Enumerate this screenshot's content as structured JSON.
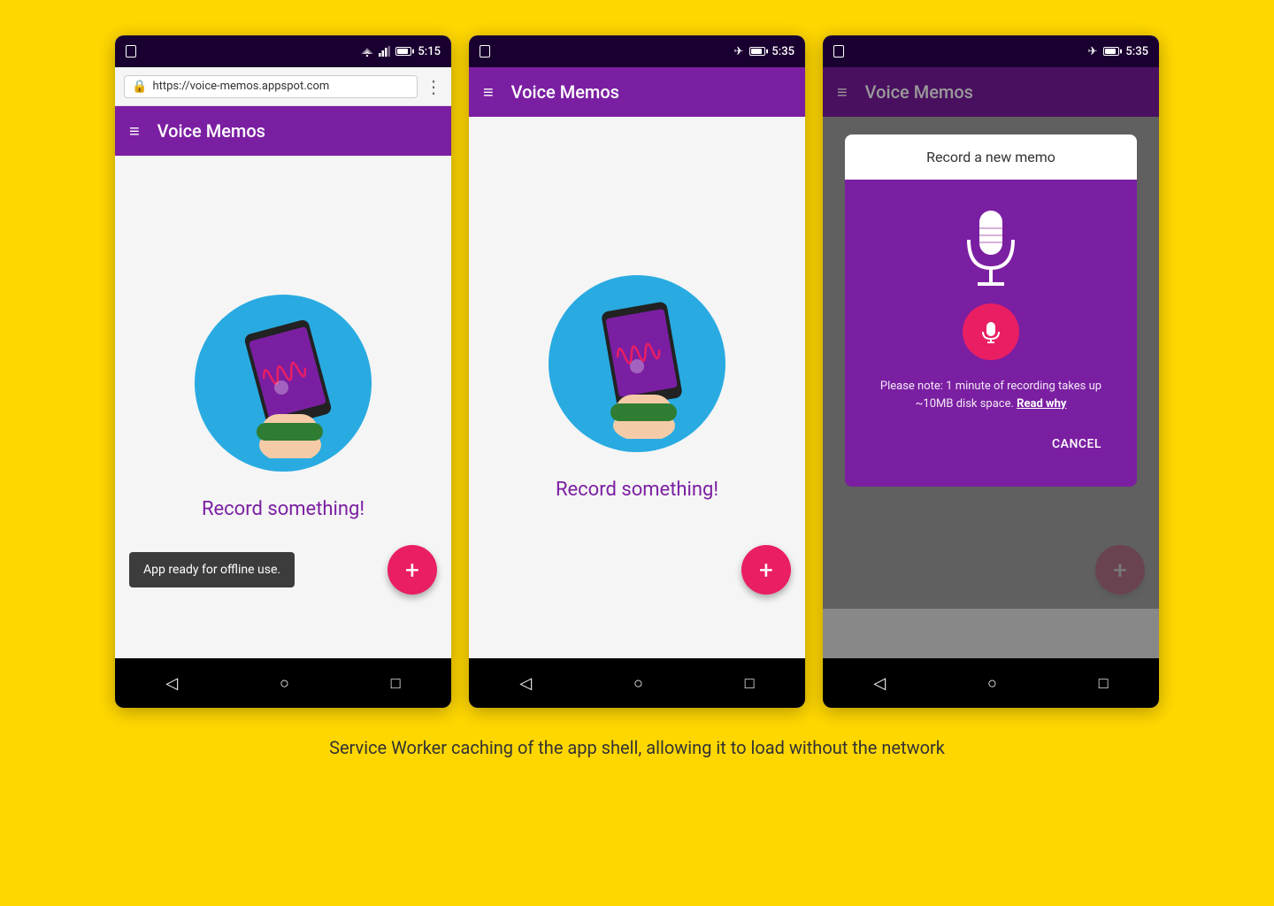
{
  "page": {
    "background_color": "#FFD700",
    "caption": "Service Worker caching of the app shell, allowing it to load without the network"
  },
  "phone1": {
    "status_bar": {
      "time": "5:15",
      "has_wifi": true,
      "has_signal": true,
      "has_battery": true
    },
    "url_bar": {
      "url": "https://voice-memos.appspot.com",
      "secure": true
    },
    "toolbar": {
      "title": "Voice Memos"
    },
    "content": {
      "record_text": "Record something!"
    },
    "snackbar": {
      "text": "App ready for offline use."
    },
    "fab_label": "+"
  },
  "phone2": {
    "status_bar": {
      "time": "5:35",
      "has_airplane": true,
      "has_battery": true
    },
    "toolbar": {
      "title": "Voice Memos"
    },
    "content": {
      "record_text": "Record something!"
    },
    "fab_label": "+"
  },
  "phone3": {
    "status_bar": {
      "time": "5:35",
      "has_airplane": true,
      "has_battery": true
    },
    "toolbar": {
      "title": "Voice Memos",
      "dimmed": true
    },
    "dialog": {
      "title": "Record a new memo",
      "note": "Please note: 1 minute of recording takes up ~10MB disk space.",
      "note_link": "Read why",
      "cancel_label": "CANCEL"
    },
    "fab_label": "+"
  },
  "nav": {
    "back": "◁",
    "home": "○",
    "recents": "□"
  }
}
